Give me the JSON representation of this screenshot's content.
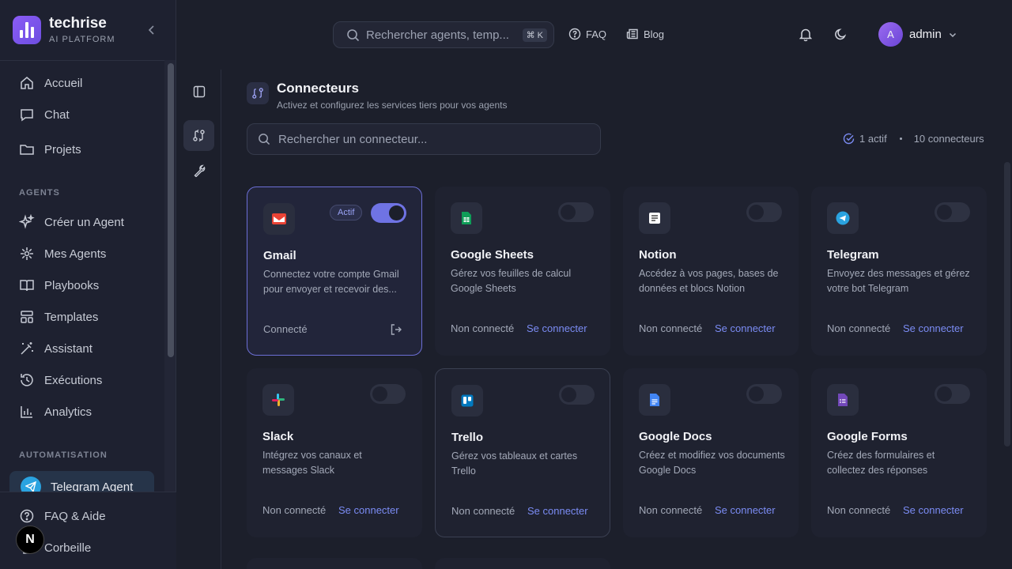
{
  "brand": {
    "title": "techrise",
    "subtitle": "AI PLATFORM"
  },
  "sidebar": {
    "main": [
      "Accueil",
      "Chat",
      "Projets"
    ],
    "agents_label": "AGENTS",
    "agents": [
      "Créer un Agent",
      "Mes Agents",
      "Playbooks",
      "Templates",
      "Assistant",
      "Exécutions",
      "Analytics"
    ],
    "automation_label": "AUTOMATISATION",
    "active_automation": "Telegram Agent",
    "bottom": [
      "FAQ & Aide",
      "Corbeille"
    ]
  },
  "topbar": {
    "search_placeholder": "Rechercher agents, temp...",
    "shortcut": "⌘ K",
    "faq": "FAQ",
    "blog": "Blog",
    "user": {
      "initial": "A",
      "name": "admin"
    }
  },
  "page": {
    "title": "Connecteurs",
    "subtitle": "Activez et configurez les services tiers pour vos agents",
    "search_placeholder": "Rechercher un connecteur...",
    "active_count": "1 actif",
    "total_count": "10 connecteurs"
  },
  "connectors": [
    {
      "name": "Gmail",
      "desc": "Connectez votre compte Gmail pour envoyer et recevoir des...",
      "status": "Connecté",
      "action": "",
      "badge": "Actif",
      "enabled": true
    },
    {
      "name": "Google Sheets",
      "desc": "Gérez vos feuilles de calcul Google Sheets",
      "status": "Non connecté",
      "action": "Se connecter",
      "enabled": false
    },
    {
      "name": "Notion",
      "desc": "Accédez à vos pages, bases de données et blocs Notion",
      "status": "Non connecté",
      "action": "Se connecter",
      "enabled": false
    },
    {
      "name": "Telegram",
      "desc": "Envoyez des messages et gérez votre bot Telegram",
      "status": "Non connecté",
      "action": "Se connecter",
      "enabled": false
    },
    {
      "name": "Slack",
      "desc": "Intégrez vos canaux et messages Slack",
      "status": "Non connecté",
      "action": "Se connecter",
      "enabled": false
    },
    {
      "name": "Trello",
      "desc": "Gérez vos tableaux et cartes Trello",
      "status": "Non connecté",
      "action": "Se connecter",
      "enabled": false
    },
    {
      "name": "Google Docs",
      "desc": "Créez et modifiez vos documents Google Docs",
      "status": "Non connecté",
      "action": "Se connecter",
      "enabled": false
    },
    {
      "name": "Google Forms",
      "desc": "Créez des formulaires et collectez des réponses",
      "status": "Non connecté",
      "action": "Se connecter",
      "enabled": false
    }
  ],
  "colors": {
    "accent": "#6f73e4",
    "link": "#7b8cf4",
    "background": "#1c1f2b",
    "brand": "#8b5cf6"
  }
}
